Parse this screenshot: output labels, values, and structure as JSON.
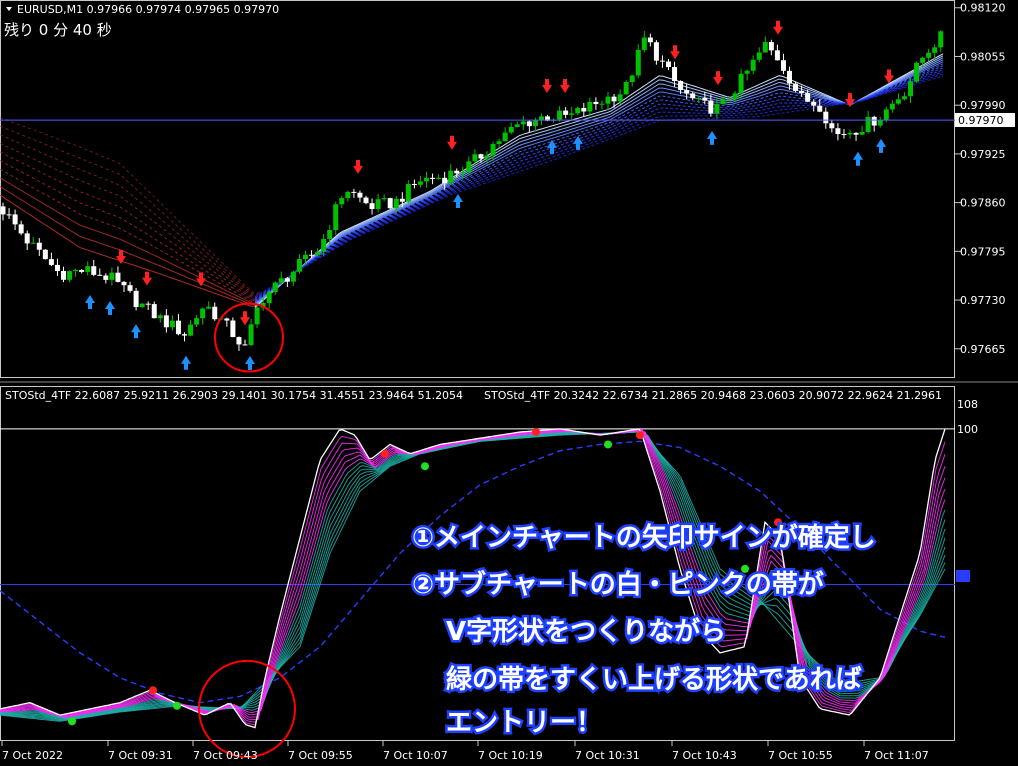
{
  "header": {
    "symbol_line": "EURUSD,M1  0.97966 0.97974 0.97965 0.97970",
    "countdown": "残り 0 分 40 秒",
    "current_price": "0.97970"
  },
  "indicator_header": {
    "label1": "STOStd_4TF 22.6087 25.9211 26.2903 29.1401 30.1754 31.4551 23.9464 51.2054",
    "label2": "STOStd_4TF 20.3242 22.6734 21.2865 20.9468 23.0603 20.9072 22.9624 21.2961"
  },
  "annotation": {
    "lines": [
      "①メインチャートの矢印サインが確定し",
      "②サブチャートの白・ピンクの帯が",
      "V字形状をつくりながら",
      "緑の帯をすくい上げる形状であれば",
      "エントリー！"
    ]
  },
  "chart_data": [
    {
      "type": "candlestick",
      "title": "EURUSD,M1",
      "ohlc_header": [
        0.97966,
        0.97974,
        0.97965,
        0.9797
      ],
      "y_ticks": [
        "0.98120",
        "0.98055",
        "0.97990",
        "0.97925",
        "0.97860",
        "0.97795",
        "0.97730",
        "0.97665"
      ],
      "ylim": [
        0.9763,
        0.98125
      ],
      "last_price": 0.9797,
      "close_path": [
        [
          0,
          0.97855
        ],
        [
          30,
          0.97805
        ],
        [
          60,
          0.97765
        ],
        [
          85,
          0.9777
        ],
        [
          110,
          0.9776
        ],
        [
          135,
          0.9773
        ],
        [
          160,
          0.97705
        ],
        [
          185,
          0.97685
        ],
        [
          205,
          0.97725
        ],
        [
          230,
          0.9769
        ],
        [
          245,
          0.97665
        ],
        [
          260,
          0.9773
        ],
        [
          290,
          0.97765
        ],
        [
          320,
          0.978
        ],
        [
          345,
          0.9788
        ],
        [
          370,
          0.97855
        ],
        [
          395,
          0.9786
        ],
        [
          420,
          0.9789
        ],
        [
          445,
          0.97895
        ],
        [
          470,
          0.9791
        ],
        [
          495,
          0.9794
        ],
        [
          520,
          0.97965
        ],
        [
          545,
          0.97975
        ],
        [
          570,
          0.97975
        ],
        [
          600,
          0.97995
        ],
        [
          625,
          0.9801
        ],
        [
          645,
          0.9808
        ],
        [
          660,
          0.9805
        ],
        [
          680,
          0.9801
        ],
        [
          700,
          0.9799
        ],
        [
          720,
          0.97985
        ],
        [
          745,
          0.9803
        ],
        [
          765,
          0.9807
        ],
        [
          780,
          0.9805
        ],
        [
          800,
          0.98
        ],
        [
          820,
          0.9799
        ],
        [
          835,
          0.9795
        ],
        [
          860,
          0.9796
        ],
        [
          880,
          0.97975
        ],
        [
          905,
          0.9801
        ],
        [
          925,
          0.9806
        ],
        [
          940,
          0.9808
        ]
      ],
      "ribbon_fast_path": [
        [
          0,
          0.9787
        ],
        [
          80,
          0.978
        ],
        [
          160,
          0.97765
        ],
        [
          255,
          0.9772
        ],
        [
          340,
          0.9782
        ],
        [
          430,
          0.97875
        ],
        [
          520,
          0.9795
        ],
        [
          610,
          0.97985
        ],
        [
          660,
          0.9803
        ],
        [
          730,
          0.98
        ],
        [
          780,
          0.9803
        ],
        [
          850,
          0.9799
        ],
        [
          945,
          0.9806
        ]
      ],
      "ribbon_slow_path": [
        [
          0,
          0.9796
        ],
        [
          120,
          0.97895
        ],
        [
          255,
          0.97735
        ],
        [
          350,
          0.9781
        ],
        [
          450,
          0.9787
        ],
        [
          560,
          0.9792
        ],
        [
          660,
          0.9797
        ],
        [
          760,
          0.97975
        ],
        [
          860,
          0.97995
        ],
        [
          945,
          0.9803
        ]
      ],
      "sell_arrows_x": [
        121,
        147,
        201,
        245,
        358,
        452,
        547,
        565,
        675,
        718,
        778,
        850,
        889
      ],
      "buy_arrows_x": [
        90,
        110,
        136,
        186,
        250,
        458,
        552,
        578,
        712,
        858,
        881
      ],
      "highlight_circle": {
        "x": 249,
        "y": 0.9768
      }
    },
    {
      "type": "line",
      "title": "STOStd_4TF",
      "y_ticks": [
        "108",
        "100"
      ],
      "ylim": [
        0,
        108
      ],
      "mid_level": 50,
      "white_line": [
        [
          0,
          10
        ],
        [
          30,
          12
        ],
        [
          60,
          8
        ],
        [
          90,
          10
        ],
        [
          120,
          12
        ],
        [
          150,
          16
        ],
        [
          175,
          12
        ],
        [
          205,
          8
        ],
        [
          230,
          12
        ],
        [
          245,
          5
        ],
        [
          255,
          4
        ],
        [
          265,
          20
        ],
        [
          280,
          40
        ],
        [
          300,
          65
        ],
        [
          320,
          90
        ],
        [
          340,
          100
        ],
        [
          355,
          98
        ],
        [
          370,
          90
        ],
        [
          390,
          95
        ],
        [
          410,
          92
        ],
        [
          440,
          95
        ],
        [
          480,
          97
        ],
        [
          520,
          99
        ],
        [
          560,
          100
        ],
        [
          600,
          98
        ],
        [
          640,
          100
        ],
        [
          660,
          80
        ],
        [
          680,
          55
        ],
        [
          700,
          35
        ],
        [
          720,
          28
        ],
        [
          745,
          30
        ],
        [
          765,
          70
        ],
        [
          780,
          65
        ],
        [
          800,
          20
        ],
        [
          820,
          10
        ],
        [
          850,
          8
        ],
        [
          880,
          20
        ],
        [
          900,
          40
        ],
        [
          920,
          60
        ],
        [
          935,
          90
        ],
        [
          945,
          100
        ]
      ],
      "green_line": [
        [
          0,
          8
        ],
        [
          60,
          6
        ],
        [
          120,
          9
        ],
        [
          180,
          11
        ],
        [
          240,
          10
        ],
        [
          300,
          30
        ],
        [
          330,
          60
        ],
        [
          360,
          80
        ],
        [
          390,
          88
        ],
        [
          420,
          92
        ],
        [
          480,
          96
        ],
        [
          560,
          98
        ],
        [
          640,
          99
        ],
        [
          680,
          85
        ],
        [
          720,
          55
        ],
        [
          760,
          45
        ],
        [
          800,
          30
        ],
        [
          840,
          18
        ],
        [
          880,
          20
        ],
        [
          920,
          40
        ],
        [
          945,
          55
        ]
      ],
      "dashed_line": [
        [
          0,
          48
        ],
        [
          40,
          38
        ],
        [
          80,
          28
        ],
        [
          120,
          20
        ],
        [
          160,
          15
        ],
        [
          200,
          12
        ],
        [
          240,
          14
        ],
        [
          280,
          20
        ],
        [
          320,
          30
        ],
        [
          360,
          45
        ],
        [
          400,
          60
        ],
        [
          440,
          72
        ],
        [
          480,
          82
        ],
        [
          520,
          88
        ],
        [
          560,
          93
        ],
        [
          600,
          95
        ],
        [
          640,
          96
        ],
        [
          680,
          94
        ],
        [
          720,
          88
        ],
        [
          760,
          80
        ],
        [
          800,
          68
        ],
        [
          840,
          55
        ],
        [
          880,
          42
        ],
        [
          920,
          35
        ],
        [
          945,
          33
        ]
      ],
      "red_dots": [
        [
          153,
          16
        ],
        [
          385,
          92
        ],
        [
          536,
          99
        ],
        [
          640,
          98
        ],
        [
          778,
          70
        ]
      ],
      "green_dots": [
        [
          72,
          6
        ],
        [
          177,
          11
        ],
        [
          425,
          88
        ],
        [
          608,
          95
        ],
        [
          745,
          55
        ],
        [
          858,
          23
        ]
      ],
      "highlight_circle": {
        "x": 247,
        "y": 10
      }
    }
  ],
  "x_axis": {
    "ticks": [
      "7 Oct 2022",
      "7 Oct 09:31",
      "7 Oct 09:43",
      "7 Oct 09:55",
      "7 Oct 10:07",
      "7 Oct 10:19",
      "7 Oct 10:31",
      "7 Oct 10:43",
      "7 Oct 10:55",
      "7 Oct 11:07"
    ]
  },
  "colors": {
    "background": "#000000",
    "grid": "#1a1aa0",
    "axis_text": "#ffffff",
    "bull_candle": "#00c000",
    "bear_candle": "#ffffff",
    "ribbon_fast": "#8ab4ff",
    "ribbon_slow": "#2a3dff",
    "ribbon_red": "#c0302a",
    "arrow_sell": "#ff2020",
    "arrow_buy": "#1e90ff",
    "sto_white": "#ffffff",
    "sto_magenta": "#ff30ff",
    "sto_teal": "#20b2aa",
    "sto_dashed": "#2a3dff",
    "highlight_circle": "#ff0000",
    "annotation_text": "#ffffff",
    "annotation_shadow": "#1e40ff"
  }
}
